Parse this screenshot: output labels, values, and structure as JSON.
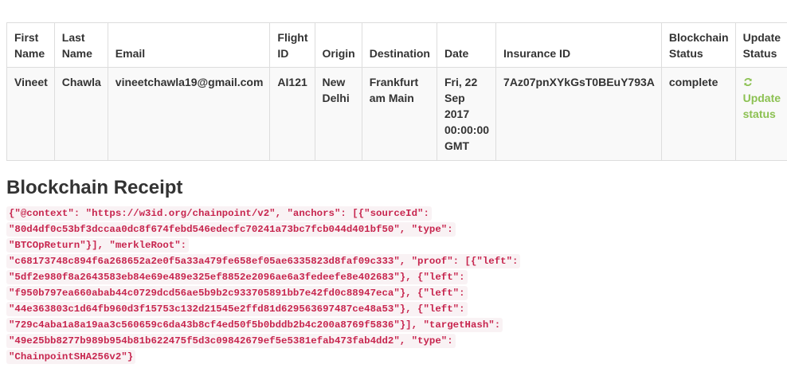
{
  "table": {
    "headers": {
      "first_name": "First Name",
      "last_name": "Last Name",
      "email": "Email",
      "flight_id": "Flight ID",
      "origin": "Origin",
      "destination": "Destination",
      "date": "Date",
      "insurance_id": "Insurance ID",
      "blockchain_status": "Blockchain Status",
      "update_status": "Update Status"
    },
    "row": {
      "first_name": "Vineet",
      "last_name": "Chawla",
      "email": "vineetchawla19@gmail.com",
      "flight_id": "AI121",
      "origin": "New Delhi",
      "destination": "Frankfurt am Main",
      "date": "Fri, 22 Sep 2017 00:00:00 GMT",
      "insurance_id": "7Az07pnXYkGsT0BEuY793A",
      "blockchain_status": "complete",
      "update_link": "Update status",
      "update_icon": "refresh-icon"
    }
  },
  "receipt": {
    "title": "Blockchain Receipt",
    "lines": [
      "{\"@context\": \"https://w3id.org/chainpoint/v2\", \"anchors\": [{\"sourceId\":",
      "\"80d4df0c53bf3dccaa0dc8f674febd546edecfc70241a73bc7fcb044d401bf50\", \"type\":",
      "\"BTCOpReturn\"}], \"merkleRoot\":",
      "\"c68173748c894f6a268652a2e0f5a33a479fe658ef05ae6335823d8faf09c333\", \"proof\": [{\"left\":",
      "\"5df2e980f8a2643583eb84e69e489e325ef8852e2096ae6a3fedeefe8e402683\"}, {\"left\":",
      "\"f950b797ea660abab44c0729dcd56ae5b9b2c933705891bb7e42fd0c88947eca\"}, {\"left\":",
      "\"44e363803c1d64fb960d3f15753c132d21545e2ffd81d629563697487ce48a53\"}, {\"left\":",
      "\"729c4aba1a8a19aa3c560659c6da43b8cf4ed50f5b0bddb2b4c200a8769f5836\"}], \"targetHash\":",
      "\"49e25bb8277b989b954b81b622475f5d3c09842679ef5e5381efab473fab4dd2\", \"type\":",
      "\"ChainpointSHA256v2\"}"
    ]
  },
  "colors": {
    "code_text": "#c7254e",
    "code_bg": "#f9f2f4",
    "link_green": "#8cc152",
    "row_bg": "#f9f9f9",
    "border": "#dddddd"
  }
}
